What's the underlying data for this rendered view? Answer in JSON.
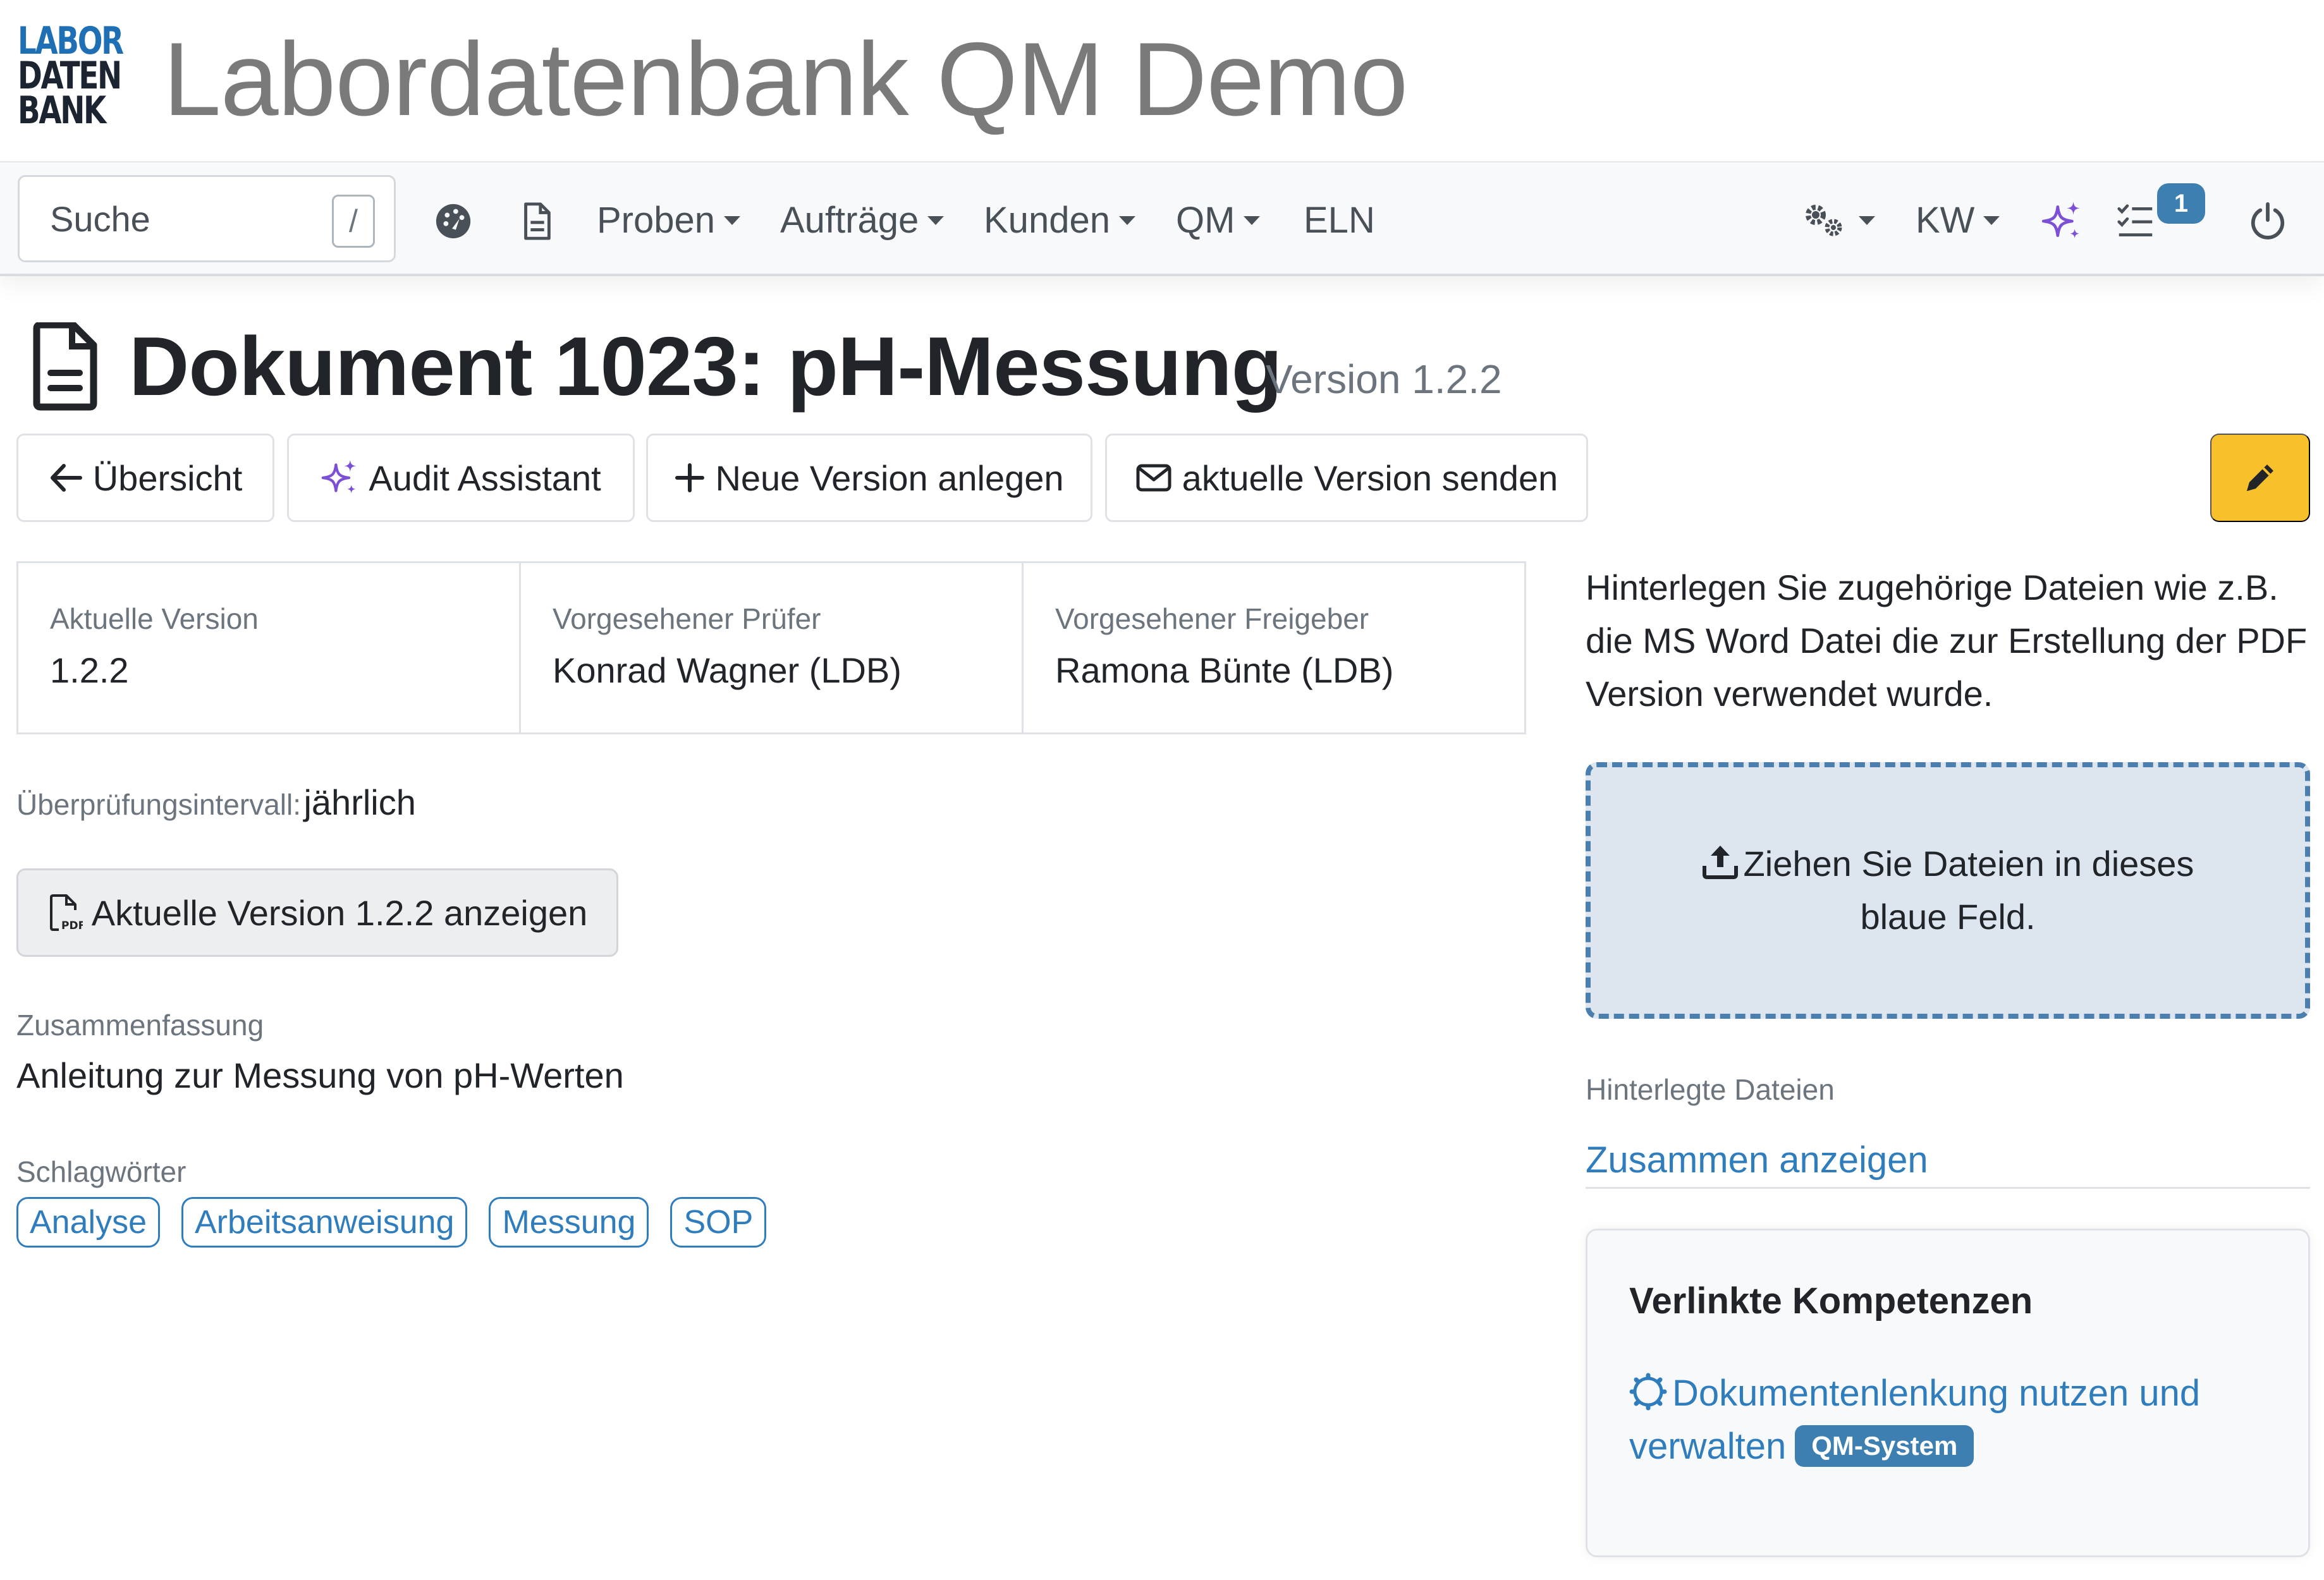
{
  "brand": {
    "logo": {
      "line1": "LABOR",
      "line2": "DATEN",
      "line3": "BANK"
    },
    "title": "Labordatenbank QM Demo"
  },
  "navbar": {
    "search_placeholder": "Suche",
    "search_shortcut": "/",
    "items": [
      {
        "label": "Proben",
        "dropdown": true
      },
      {
        "label": "Aufträge",
        "dropdown": true
      },
      {
        "label": "Kunden",
        "dropdown": true
      },
      {
        "label": "QM",
        "dropdown": true
      },
      {
        "label": "ELN",
        "dropdown": false
      }
    ],
    "user_label": "KW",
    "tasks_badge": "1",
    "icons": [
      "dashboard-icon",
      "document-icon",
      "settings-gears-icon",
      "sparkles-icon",
      "task-list-icon",
      "power-icon"
    ]
  },
  "page": {
    "title": "Dokument 1023: pH-Messung",
    "version_label": "Version 1.2.2"
  },
  "actions": {
    "overview": "Übersicht",
    "audit": "Audit Assistant",
    "new_version": "Neue Version anlegen",
    "send_version": "aktuelle Version senden"
  },
  "info": {
    "current_version_label": "Aktuelle Version",
    "current_version_value": "1.2.2",
    "reviewer_label": "Vorgesehener Prüfer",
    "reviewer_value": "Konrad Wagner (LDB)",
    "approver_label": "Vorgesehener Freigeber",
    "approver_value": "Ramona Bünte (LDB)"
  },
  "interval": {
    "label": "Überprüfungsintervall:",
    "value": "jährlich"
  },
  "pdf_button": "Aktuelle Version 1.2.2 anzeigen",
  "summary": {
    "label": "Zusammenfassung",
    "text": "Anleitung zur Messung von pH-Werten"
  },
  "keywords": {
    "label": "Schlagwörter",
    "tags": [
      "Analyse",
      "Arbeitsanweisung",
      "Messung",
      "SOP"
    ]
  },
  "files": {
    "hint": "Hinterlegen Sie zugehörige Dateien wie z.B. die MS Word Datei die zur Erstellung der PDF Version verwendet wurde.",
    "dropzone": "Ziehen Sie Dateien in dieses blaue Feld.",
    "stored_label": "Hinterlegte Dateien",
    "show_all": "Zusammen anzeigen"
  },
  "competences": {
    "title": "Verlinkte Kompetenzen",
    "link": "Dokumentenlenkung nutzen und verwalten",
    "badge": "QM-System"
  },
  "colors": {
    "accent": "#2f7dbd",
    "badge": "#3d7fb0",
    "edit": "#f8c12c",
    "sparkle": "#7b4fd6"
  }
}
